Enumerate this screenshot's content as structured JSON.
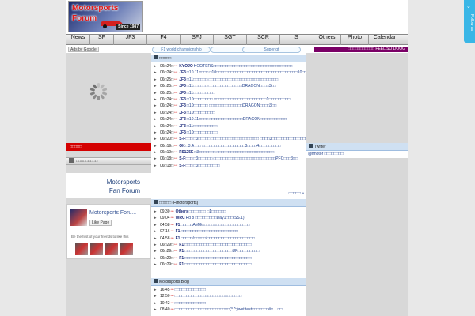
{
  "site": {
    "logo_line1": "Motorsports",
    "logo_line2": "Forum",
    "logo_since": "Since 1987"
  },
  "nav": [
    "News",
    "SF",
    "JF3",
    "F4",
    "SFJ",
    "SGT",
    "SCR",
    "S",
    "Others",
    "Photo",
    "Calendar"
  ],
  "subbar": {
    "ads_label": "Ads by Google",
    "pill1": "F1 world championship",
    "pill2": "F1",
    "pill3": "Super gt",
    "banner": "□□□□□□□□□□□ FEEL SO DOOG"
  },
  "left": {
    "events_label": "□□□□□",
    "community_menu": "□□□□□□□□□",
    "fan_forum_line1": "Motorsports",
    "fan_forum_line2": "Fan Forum",
    "fb_name": "Motorsports Foru...",
    "fb_like": "Like Page",
    "fb_first": "Be the first of your friends to like this"
  },
  "center": {
    "latest_news_title": "□□□□□",
    "latest_news": [
      {
        "date": "06□24□",
        "tag": "KYOJO",
        "title": "HOOTERS□□□□□□□□□□□□□□□□□□□□□□□□□□□□□□□□□"
      },
      {
        "date": "06□24□",
        "tag": "JF3",
        "title": "□10.11□□□□ □10□□□□□□□□□□□□□□□□□□□□□□□□□□□□□□□□□□10□□2□□□□TDP□□□□□□1.2□□□□□□ (TOYOTA)"
      },
      {
        "date": "06□25□",
        "tag": "JF3",
        "title": "□11□□□□□□ □□□□□□□□□□□□□□□□□□□□□□□□□□□□□"
      },
      {
        "date": "06□25□",
        "tag": "JF3",
        "title": "□11□□□□□□ □□□□□□□□□□□□□□DRAGON□□□□3□□"
      },
      {
        "date": "06□25□",
        "tag": "JF3",
        "title": "□11□□□□□□□□□"
      },
      {
        "date": "06□24□",
        "tag": "JF3",
        "title": "□10□□□□□□□□ □□□□□□□□□□□□□□□□□□□□□□1□□□□□□□□□"
      },
      {
        "date": "06□24□",
        "tag": "JF3",
        "title": "□10□□□□□□ □□□□□□□□□□□□□□DRAGON□□□□3□□"
      },
      {
        "date": "06□24□",
        "tag": "JF3",
        "title": "□10□□□□□□□□□"
      },
      {
        "date": "06□24□",
        "tag": "JF3",
        "title": "□10.11□□□□ □□□□□□□□□□□□□□DRAGON□□□□□□□□□□□"
      },
      {
        "date": "06□24□",
        "tag": "JF3",
        "title": "□11□□□□□□□□□□"
      },
      {
        "date": "06□24□",
        "tag": "JF3",
        "title": "□10□□□□□□□□□□"
      },
      {
        "date": "06□20□",
        "tag": "S-F□□□",
        "title": "□3□□□□□ □□□□□□□□□□□□□□□□□□□□ □□□□3□□□□□□□□□□□□□□□□□□□□□□□□□□□□□□□□□ (Le Beausset)"
      },
      {
        "date": "06□19□",
        "tag": "OK",
        "title": "□3.4□□□ □□□□□□□□□□□□□□□□□□3□□□□4□□□□□□□□□"
      },
      {
        "date": "06□19□",
        "tag": "FS125E",
        "title": "□3□□□□□□□ □□□□□□□□□□□□□□□□□□□□□□□□"
      },
      {
        "date": "06□18□",
        "tag": "S-F□□□",
        "title": "□3□□□□□□ □□□□□□□□□□□□□□□□□□□□□□□□□□PFC□□□3□□"
      },
      {
        "date": "06□18□",
        "tag": "S-F□□□",
        "title": "□3□□□□□□□□□"
      }
    ],
    "latest_more": "□□□□□ »",
    "overseas_title": "□□□□□ (Fmotorsports)",
    "overseas": [
      {
        "date": "09:30",
        "tag": "Others",
        "title": "□□□□□□□ □1□□□□□□"
      },
      {
        "date": "09:04",
        "tag": "WRC",
        "title": "Rd 8 □□□□□□□□□Day1□□□(SS.1)"
      },
      {
        "date": "04:58",
        "tag": "F1",
        "title": "□□□□□AMG□□□□□□□□□□□□□□□□□□□□"
      },
      {
        "date": "07:16",
        "tag": "F1",
        "title": "□□□□□□□□□□□□□□□□□□□□□□□□"
      },
      {
        "date": "04:58",
        "tag": "F1",
        "title": "□□□□□/□□□□□/□□□□□□□□□□□□□□□□□□□□"
      },
      {
        "date": "06□29□",
        "tag": "F1",
        "title": "□□□□□□□□□□□□□□□□□□□□□□□□□□□□"
      },
      {
        "date": "06□29□",
        "tag": "F1",
        "title": "□□□□□□□□□□□□□□□□□□□□UP□□□□□□□□□"
      },
      {
        "date": "06□29□",
        "tag": "F1",
        "title": "□□□□□□□□□□□□□□□□□□□□□□□□□□□□"
      },
      {
        "date": "06□29□",
        "tag": "F1",
        "title": "□□□□□□□□□□□□□□□□□□□□□□□□□□□□"
      }
    ],
    "blog_title": "Motorsports Blog",
    "blog": [
      {
        "date": "16:45",
        "title": "□□□□□□□□□□□□□"
      },
      {
        "date": "12:50",
        "title": "□□□□□□□□□□□□□□□□□□□□□□□□□□□□"
      },
      {
        "date": "10:42",
        "title": "□□□□□□□□□□□□□"
      },
      {
        "date": "08:40",
        "title": "□□□□□□□□□□□□□□□□□□□□□□□(^ ^;)wet test□□□□□□□#□ ...□□"
      }
    ]
  },
  "right": {
    "twitter_title": "Twitter",
    "twitter_handle": "@fmotor □□□□□□□□"
  },
  "follow": {
    "label": "Follow us"
  }
}
